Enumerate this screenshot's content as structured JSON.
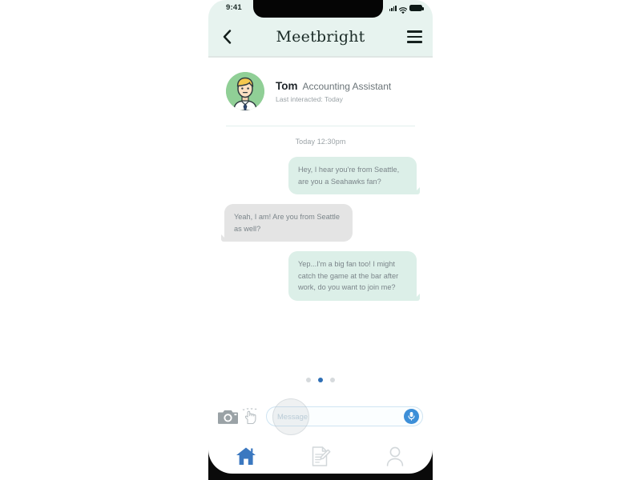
{
  "status_bar": {
    "time": "9:41",
    "icons": [
      "signal-icon",
      "wifi-icon",
      "battery-icon"
    ]
  },
  "app_bar": {
    "back_icon": "chevron-left-icon",
    "title": "Meetbright",
    "menu_icon": "hamburger-menu-icon"
  },
  "contact": {
    "avatar_icon": "person-avatar-icon",
    "name": "Tom",
    "role": "Accounting Assistant",
    "last_interacted": "Last interacted: Today"
  },
  "chat": {
    "timestamp": "Today 12:30pm",
    "messages": [
      {
        "side": "out",
        "text": "Hey, I hear you're from Seattle, are you a Seahawks fan?"
      },
      {
        "side": "in",
        "text": "Yeah, I am! Are you from Seattle as well?"
      },
      {
        "side": "out",
        "text": "Yep...I'm a big fan too! I might catch the game at the bar after work, do you want to join me?"
      }
    ]
  },
  "pagination": {
    "total": 3,
    "active_index": 1
  },
  "composer": {
    "camera_icon": "camera-icon",
    "tap_cursor_icon": "tap-hand-icon",
    "placeholder": "Message",
    "value": "",
    "mic_icon": "microphone-icon"
  },
  "bottom_nav": {
    "items": [
      {
        "icon": "home-icon",
        "active": true
      },
      {
        "icon": "document-edit-icon",
        "active": false
      },
      {
        "icon": "profile-icon",
        "active": false
      }
    ]
  },
  "colors": {
    "header_bg": "#e7f3ef",
    "bubble_out": "#dcefe8",
    "bubble_in": "#e4e4e4",
    "accent_blue": "#3d8fd8",
    "nav_active": "#3b78c0",
    "avatar_bg": "#90cf96"
  }
}
